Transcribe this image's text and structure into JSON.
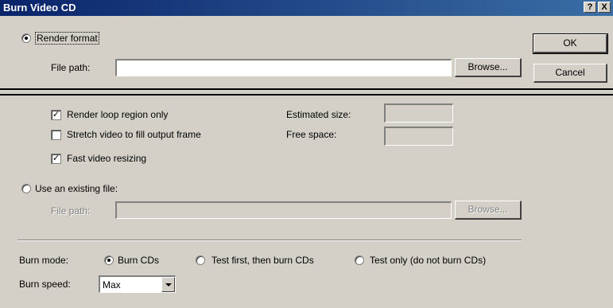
{
  "window": {
    "title": "Burn Video CD",
    "help_glyph": "?",
    "close_glyph": "X"
  },
  "render": {
    "option_label": "Render format",
    "selected": true,
    "file_path_label": "File path:",
    "file_path_value": "",
    "browse_label": "Browse...",
    "loop_region_label": "Render loop region only",
    "loop_region_checked": true,
    "stretch_label": "Stretch video to fill output frame",
    "stretch_checked": false,
    "fast_resize_label": "Fast video resizing",
    "fast_resize_checked": true,
    "estimated_size_label": "Estimated size:",
    "estimated_size_value": "",
    "free_space_label": "Free space:",
    "free_space_value": ""
  },
  "existing": {
    "option_label": "Use an existing file:",
    "selected": false,
    "file_path_label": "File path:",
    "file_path_value": "",
    "browse_label": "Browse..."
  },
  "dialog_buttons": {
    "ok_label": "OK",
    "cancel_label": "Cancel"
  },
  "burn": {
    "mode_label": "Burn mode:",
    "modes": [
      {
        "label": "Burn CDs",
        "selected": true
      },
      {
        "label": "Test first, then burn CDs",
        "selected": false
      },
      {
        "label": "Test only (do not burn CDs)",
        "selected": false
      }
    ],
    "speed_label": "Burn speed:",
    "speed_value": "Max"
  }
}
